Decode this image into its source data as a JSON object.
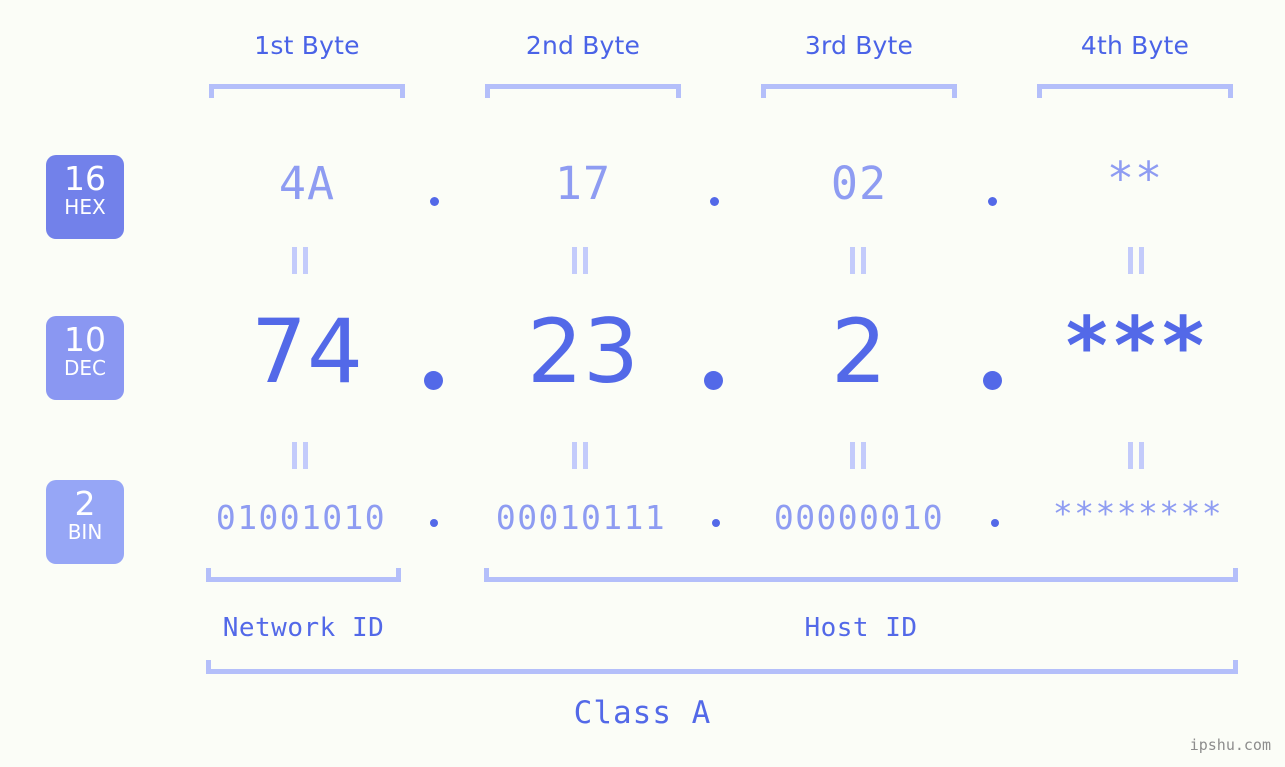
{
  "meta": {
    "background_color": "#fbfdf7",
    "accent_color": "#5369e8",
    "light_accent_color": "#8e9cf2",
    "bracket_color": "#b4bffa"
  },
  "byte_headers": [
    {
      "label": "1st Byte"
    },
    {
      "label": "2nd Byte"
    },
    {
      "label": "3rd Byte"
    },
    {
      "label": "4th Byte"
    }
  ],
  "radix_badges": [
    {
      "number": "16",
      "name": "HEX",
      "color": "#7281ea"
    },
    {
      "number": "10",
      "name": "DEC",
      "color": "#8a97f2"
    },
    {
      "number": "2",
      "name": "BIN",
      "color": "#96a6f6"
    }
  ],
  "rows": {
    "hex": {
      "values": [
        "4A",
        "17",
        "02",
        "**"
      ],
      "separator": "."
    },
    "dec": {
      "values": [
        "74",
        "23",
        "2",
        "***"
      ],
      "separator": "."
    },
    "bin": {
      "values": [
        "01001010",
        "00010111",
        "00000010",
        "********"
      ],
      "separator": "."
    }
  },
  "equality_marks": {
    "symbol": "||",
    "count_per_row": 4
  },
  "segments": {
    "network_id": {
      "label": "Network ID"
    },
    "host_id": {
      "label": "Host ID"
    },
    "class": {
      "label": "Class  A"
    }
  },
  "watermark": {
    "text": "ipshu.com"
  }
}
